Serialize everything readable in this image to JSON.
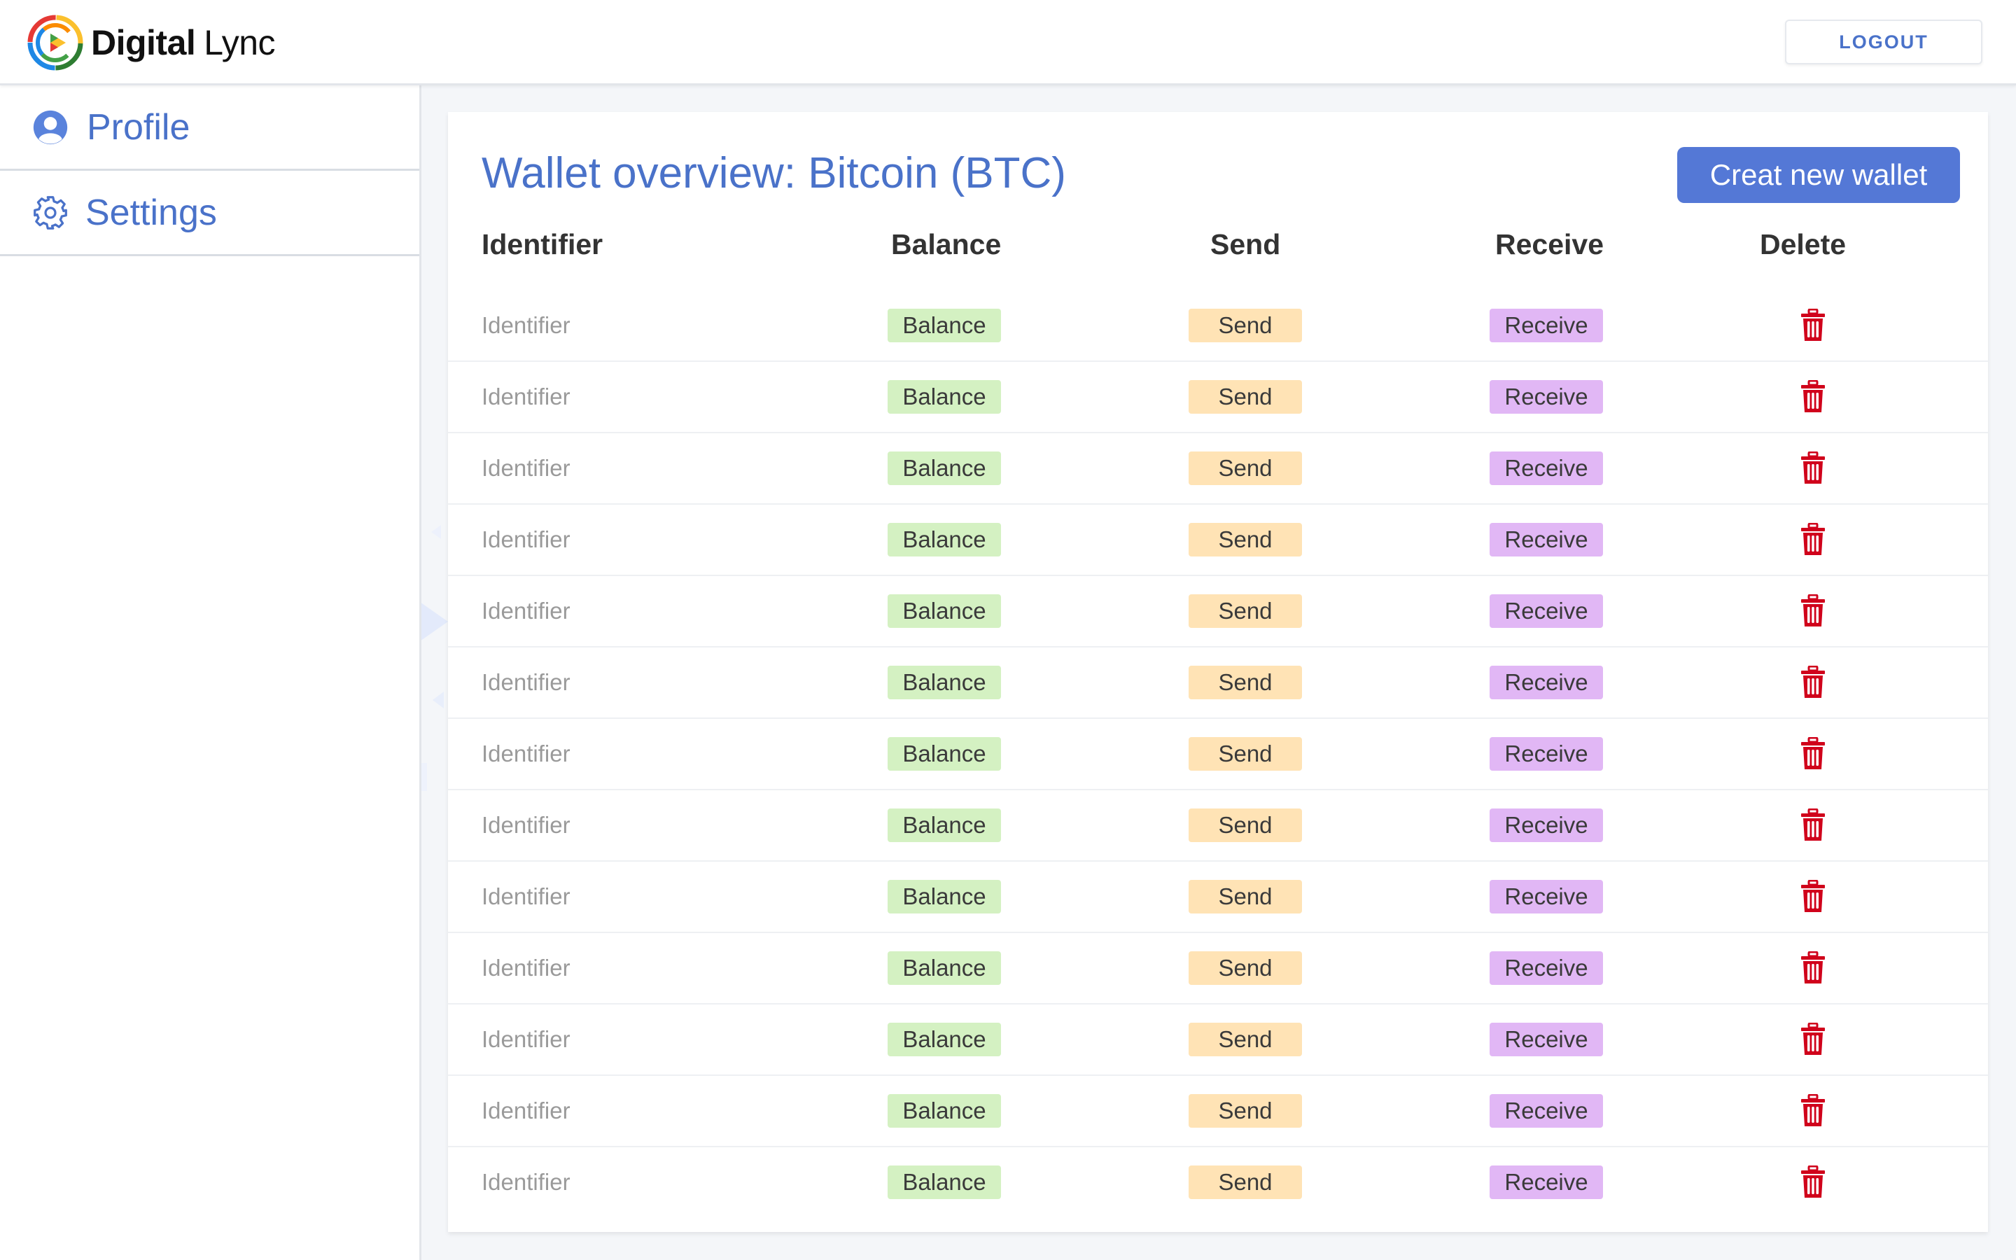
{
  "header": {
    "logo_primary": "Digital",
    "logo_secondary": "Lync",
    "logout_label": "LOGOUT"
  },
  "sidebar": {
    "items": [
      {
        "label": "Profile",
        "icon": "user-icon"
      },
      {
        "label": "Settings",
        "icon": "gear-icon"
      }
    ]
  },
  "main": {
    "title": "Wallet overview: Bitcoin (BTC)",
    "create_button_label": "Creat new wallet",
    "columns": [
      "Identifier",
      "Balance",
      "Send",
      "Receive",
      "Delete"
    ],
    "rows": [
      {
        "identifier": "Identifier",
        "balance": "Balance",
        "send": "Send",
        "receive": "Receive"
      },
      {
        "identifier": "Identifier",
        "balance": "Balance",
        "send": "Send",
        "receive": "Receive"
      },
      {
        "identifier": "Identifier",
        "balance": "Balance",
        "send": "Send",
        "receive": "Receive"
      },
      {
        "identifier": "Identifier",
        "balance": "Balance",
        "send": "Send",
        "receive": "Receive"
      },
      {
        "identifier": "Identifier",
        "balance": "Balance",
        "send": "Send",
        "receive": "Receive"
      },
      {
        "identifier": "Identifier",
        "balance": "Balance",
        "send": "Send",
        "receive": "Receive"
      },
      {
        "identifier": "Identifier",
        "balance": "Balance",
        "send": "Send",
        "receive": "Receive"
      },
      {
        "identifier": "Identifier",
        "balance": "Balance",
        "send": "Send",
        "receive": "Receive"
      },
      {
        "identifier": "Identifier",
        "balance": "Balance",
        "send": "Send",
        "receive": "Receive"
      },
      {
        "identifier": "Identifier",
        "balance": "Balance",
        "send": "Send",
        "receive": "Receive"
      },
      {
        "identifier": "Identifier",
        "balance": "Balance",
        "send": "Send",
        "receive": "Receive"
      },
      {
        "identifier": "Identifier",
        "balance": "Balance",
        "send": "Send",
        "receive": "Receive"
      },
      {
        "identifier": "Identifier",
        "balance": "Balance",
        "send": "Send",
        "receive": "Receive"
      }
    ]
  },
  "colors": {
    "accent": "#4a72c9",
    "button": "#5478d6",
    "balance_pill": "#d4f1c2",
    "send_pill": "#ffe3b5",
    "receive_pill": "#e1b7f5",
    "delete_icon": "#d0021b"
  },
  "icons": {
    "delete": "trash-icon",
    "logo": "digital-lync-logo"
  }
}
